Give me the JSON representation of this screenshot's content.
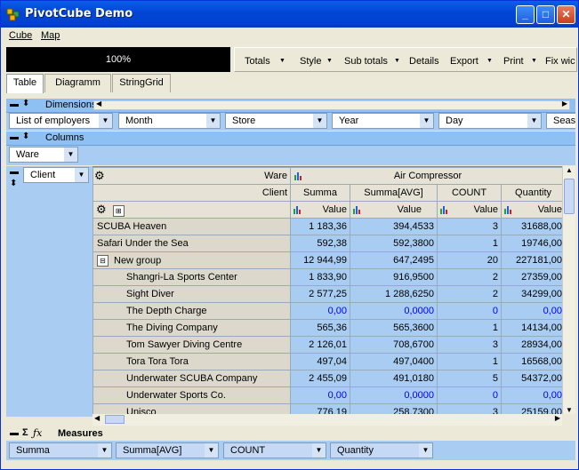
{
  "window": {
    "title": "PivotCube Demo"
  },
  "menu": [
    {
      "label": "Cube"
    },
    {
      "label": "Map"
    }
  ],
  "progress": {
    "label": "100%",
    "value": 1.0
  },
  "toolbar": {
    "items": [
      {
        "label": "Totals"
      },
      {
        "label": "Style"
      },
      {
        "label": "Sub totals"
      },
      {
        "label": "Details"
      },
      {
        "label": "Export"
      },
      {
        "label": "Print"
      },
      {
        "label": "Fix wic"
      }
    ]
  },
  "tabs": [
    {
      "label": "Table"
    },
    {
      "label": "Diagramm"
    },
    {
      "label": "StringGrid"
    }
  ],
  "dimensions": {
    "label": "Dimensions",
    "items": [
      "List of employers",
      "Month",
      "Store",
      "Year",
      "Day",
      "Seas"
    ]
  },
  "columns": {
    "label": "Columns",
    "items": [
      "Ware"
    ]
  },
  "rows": {
    "items": [
      "Client"
    ]
  },
  "grid": {
    "ware_label": "Ware",
    "ware_value": "Air Compressor",
    "client_label": "Client",
    "measures": [
      "Summa",
      "Summa[AVG]",
      "COUNT",
      "Quantity"
    ],
    "value_label": "Value",
    "rows": [
      {
        "name": "SCUBA Heaven",
        "indent": 0,
        "values": [
          "1 183,36",
          "394,4533",
          "3",
          "31688,00"
        ]
      },
      {
        "name": "Safari Under the Sea",
        "indent": 0,
        "values": [
          "592,38",
          "592,3800",
          "1",
          "19746,00"
        ]
      },
      {
        "name": "New group",
        "indent": 0,
        "group": true,
        "values": [
          "12 944,99",
          "647,2495",
          "20",
          "227181,00"
        ]
      },
      {
        "name": "Shangri-La Sports Center",
        "indent": 1,
        "values": [
          "1 833,90",
          "916,9500",
          "2",
          "27359,00"
        ]
      },
      {
        "name": "Sight Diver",
        "indent": 1,
        "values": [
          "2 577,25",
          "1 288,6250",
          "2",
          "34299,00"
        ]
      },
      {
        "name": "The Depth Charge",
        "indent": 1,
        "zero": true,
        "values": [
          "0,00",
          "0,0000",
          "0",
          "0,00"
        ]
      },
      {
        "name": "The Diving Company",
        "indent": 1,
        "values": [
          "565,36",
          "565,3600",
          "1",
          "14134,00"
        ]
      },
      {
        "name": "Tom Sawyer Diving Centre",
        "indent": 1,
        "values": [
          "2 126,01",
          "708,6700",
          "3",
          "28934,00"
        ]
      },
      {
        "name": "Tora Tora Tora",
        "indent": 1,
        "values": [
          "497,04",
          "497,0400",
          "1",
          "16568,00"
        ]
      },
      {
        "name": "Underwater SCUBA Company",
        "indent": 1,
        "values": [
          "2 455,09",
          "491,0180",
          "5",
          "54372,00"
        ]
      },
      {
        "name": "Underwater Sports Co.",
        "indent": 1,
        "zero": true,
        "values": [
          "0,00",
          "0,0000",
          "0",
          "0,00"
        ]
      },
      {
        "name": "Unisco",
        "indent": 1,
        "values": [
          "776,19",
          "258,7300",
          "3",
          "25159,00"
        ]
      }
    ]
  },
  "measures_panel": {
    "label": "Measures",
    "items": [
      "Summa",
      "Summa[AVG]",
      "COUNT",
      "Quantity"
    ]
  },
  "colors": {
    "accent": "#a9cdf2",
    "zero_value": "#0000ee"
  }
}
